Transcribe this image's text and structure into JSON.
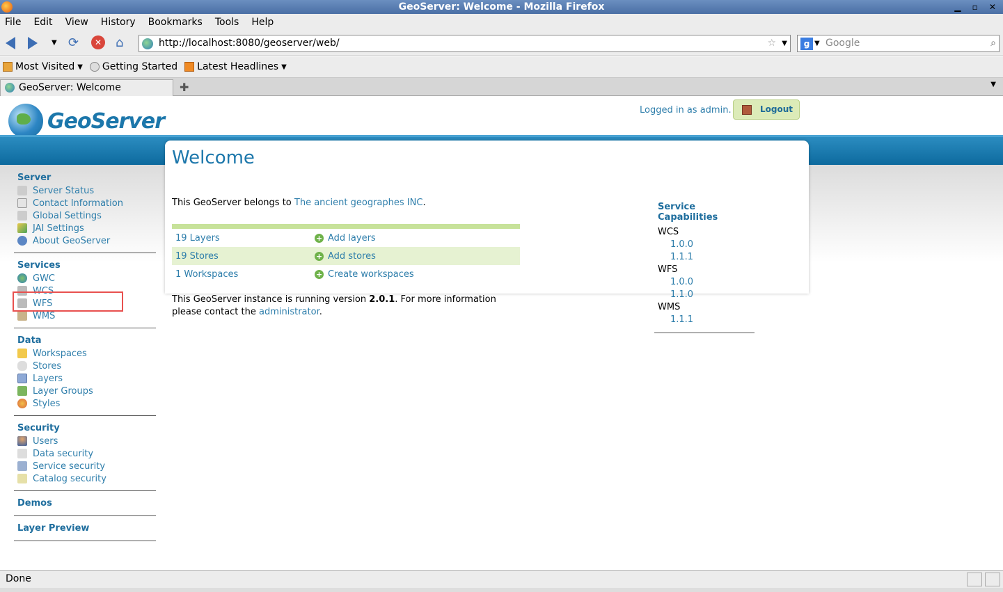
{
  "window": {
    "title": "GeoServer: Welcome - Mozilla Firefox"
  },
  "menu": [
    "File",
    "Edit",
    "View",
    "History",
    "Bookmarks",
    "Tools",
    "Help"
  ],
  "nav": {
    "url": "http://localhost:8080/geoserver/web/",
    "search_placeholder": "Google"
  },
  "bookmarks": [
    "Most Visited",
    "Getting Started",
    "Latest Headlines"
  ],
  "tabs": [
    {
      "label": "GeoServer: Welcome"
    }
  ],
  "header": {
    "logo_text": "GeoServer",
    "logged_in": "Logged in as admin.",
    "logout": "Logout"
  },
  "sidebar": {
    "server": {
      "title": "Server",
      "items": [
        "Server Status",
        "Contact Information",
        "Global Settings",
        "JAI Settings",
        "About GeoServer"
      ]
    },
    "services": {
      "title": "Services",
      "items": [
        "GWC",
        "WCS",
        "WFS",
        "WMS"
      ]
    },
    "data": {
      "title": "Data",
      "items": [
        "Workspaces",
        "Stores",
        "Layers",
        "Layer Groups",
        "Styles"
      ]
    },
    "security": {
      "title": "Security",
      "items": [
        "Users",
        "Data security",
        "Service security",
        "Catalog security"
      ]
    },
    "demos": {
      "title": "Demos"
    },
    "layer_preview": {
      "title": "Layer Preview"
    }
  },
  "main": {
    "title": "Welcome",
    "belongs_prefix": "This GeoServer belongs to ",
    "belongs_link": "The ancient geographes INC",
    "belongs_suffix": ".",
    "summary": [
      {
        "count": "19 Layers",
        "action": "Add layers"
      },
      {
        "count": "19 Stores",
        "action": "Add stores"
      },
      {
        "count": "1 Workspaces",
        "action": "Create workspaces"
      }
    ],
    "version_prefix": "This GeoServer instance is running version ",
    "version": "2.0.1",
    "version_mid": ". For more information please contact the ",
    "admin_link": "administrator",
    "version_suffix": "."
  },
  "capabilities": {
    "title": "Service Capabilities",
    "services": [
      {
        "name": "WCS",
        "versions": [
          "1.0.0",
          "1.1.1"
        ]
      },
      {
        "name": "WFS",
        "versions": [
          "1.0.0",
          "1.1.0"
        ]
      },
      {
        "name": "WMS",
        "versions": [
          "1.1.1"
        ]
      }
    ]
  },
  "status": {
    "text": "Done"
  }
}
